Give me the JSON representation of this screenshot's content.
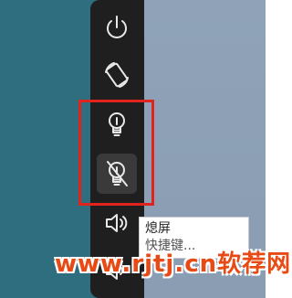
{
  "toolbar": {
    "buttons": [
      {
        "name": "power",
        "icon": "power-icon"
      },
      {
        "name": "rotate",
        "icon": "rotate-screen-icon"
      },
      {
        "name": "brightness",
        "icon": "lightbulb-icon"
      },
      {
        "name": "screen-off",
        "icon": "lightbulb-off-icon",
        "active": true
      },
      {
        "name": "volume-up",
        "icon": "volume-up-icon"
      },
      {
        "name": "volume-down",
        "icon": "volume-down-icon"
      }
    ]
  },
  "tooltip": {
    "title": "熄屏",
    "subtitle": "快捷键..."
  },
  "watermark": {
    "text": "www.rjtj.cn软荐网"
  },
  "colors": {
    "desktop_left": "#2e6e7e",
    "desktop_right": "#8fa2b8",
    "panel": "#1f1f1f",
    "highlight": "#e0231d",
    "watermark": "#e84a15"
  }
}
